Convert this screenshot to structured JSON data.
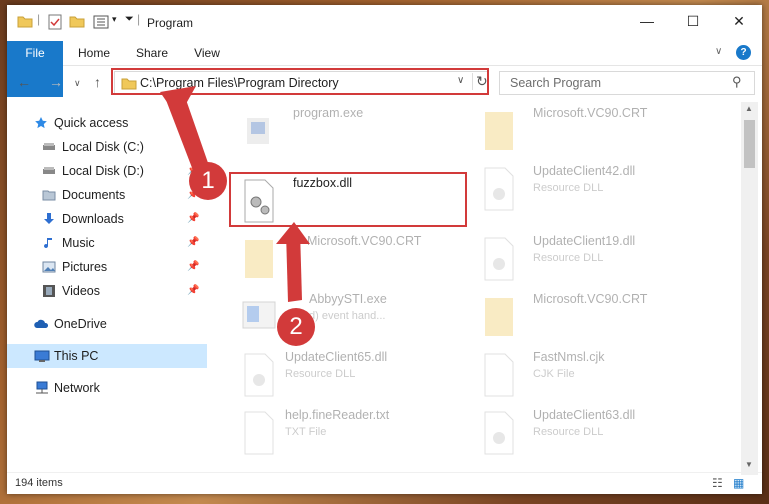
{
  "window": {
    "title": "Program"
  },
  "ribbon": {
    "tabs": [
      "File",
      "Home",
      "Share",
      "View"
    ]
  },
  "address": {
    "path": "C:\\Program Files\\Program Directory"
  },
  "search": {
    "placeholder": "Search Program"
  },
  "nav_pane": {
    "items": [
      {
        "label": "Quick access",
        "icon": "star-icon"
      },
      {
        "label": "Local Disk (C:)",
        "icon": "drive-icon"
      },
      {
        "label": "Local Disk (D:)",
        "icon": "drive-icon"
      },
      {
        "label": "Documents",
        "icon": "documents-icon"
      },
      {
        "label": "Downloads",
        "icon": "download-icon"
      },
      {
        "label": "Music",
        "icon": "music-icon"
      },
      {
        "label": "Pictures",
        "icon": "pictures-icon"
      },
      {
        "label": "Videos",
        "icon": "videos-icon"
      },
      {
        "label": "OneDrive",
        "icon": "cloud-icon"
      },
      {
        "label": "This PC",
        "icon": "computer-icon"
      },
      {
        "label": "Network",
        "icon": "network-icon"
      }
    ]
  },
  "files": [
    {
      "name": "program.exe",
      "type": ""
    },
    {
      "name": "Microsoft.VC90.CRT",
      "type": ""
    },
    {
      "name": "fuzzbox.dll",
      "type": ""
    },
    {
      "name": "UpdateClient42.dll",
      "type": "Resource DLL"
    },
    {
      "name": "Microsoft.VC90.CRT",
      "type": ""
    },
    {
      "name": "UpdateClient19.dll",
      "type": "Resource DLL"
    },
    {
      "name": "AbbyySTI.exe",
      "type": "d) event hand..."
    },
    {
      "name": "Microsoft.VC90.CRT",
      "type": ""
    },
    {
      "name": "UpdateClient65.dll",
      "type": "Resource DLL"
    },
    {
      "name": "FastNmsl.cjk",
      "type": "CJK File"
    },
    {
      "name": "help.fineReader.txt",
      "type": "TXT File"
    },
    {
      "name": "UpdateClient63.dll",
      "type": "Resource DLL"
    }
  ],
  "status": {
    "items": "194 items"
  },
  "annotations": {
    "step1": "1",
    "step2": "2"
  },
  "colors": {
    "accent": "#1979ca",
    "highlight": "#d23a3a",
    "selection": "#cce8ff"
  }
}
